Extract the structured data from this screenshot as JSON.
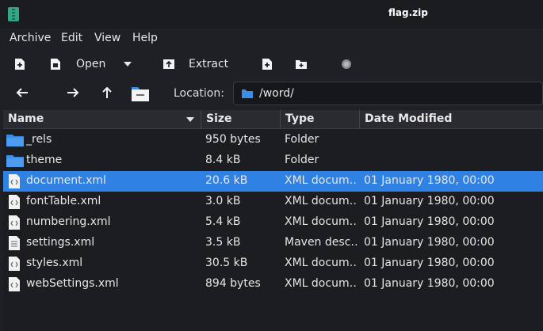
{
  "window": {
    "title": "flag.zip"
  },
  "menu": [
    "Archive",
    "Edit",
    "View",
    "Help"
  ],
  "toolbar": {
    "open_label": "Open",
    "extract_label": "Extract"
  },
  "location": {
    "label": "Location:",
    "path": "/word/"
  },
  "columns": [
    "Name",
    "Size",
    "Type",
    "Date Modified"
  ],
  "rows": [
    {
      "name": "_rels",
      "size": "950 bytes",
      "type": "Folder",
      "date": "",
      "kind": "folder"
    },
    {
      "name": "theme",
      "size": "8.4 kB",
      "type": "Folder",
      "date": "",
      "kind": "folder"
    },
    {
      "name": "document.xml",
      "size": "20.6 kB",
      "type": "XML docum…",
      "date": "01 January 1980, 00:00",
      "kind": "xml",
      "selected": true
    },
    {
      "name": "fontTable.xml",
      "size": "3.0 kB",
      "type": "XML docum…",
      "date": "01 January 1980, 00:00",
      "kind": "xml"
    },
    {
      "name": "numbering.xml",
      "size": "5.4 kB",
      "type": "XML docum…",
      "date": "01 January 1980, 00:00",
      "kind": "xml"
    },
    {
      "name": "settings.xml",
      "size": "3.5 kB",
      "type": "Maven desc…",
      "date": "01 January 1980, 00:00",
      "kind": "text"
    },
    {
      "name": "styles.xml",
      "size": "30.5 kB",
      "type": "XML docum…",
      "date": "01 January 1980, 00:00",
      "kind": "xml"
    },
    {
      "name": "webSettings.xml",
      "size": "894 bytes",
      "type": "XML docum…",
      "date": "01 January 1980, 00:00",
      "kind": "xml"
    }
  ],
  "colors": {
    "selection": "#2f82e4",
    "folder": "#3a8ee8",
    "background": "#1e2025"
  }
}
